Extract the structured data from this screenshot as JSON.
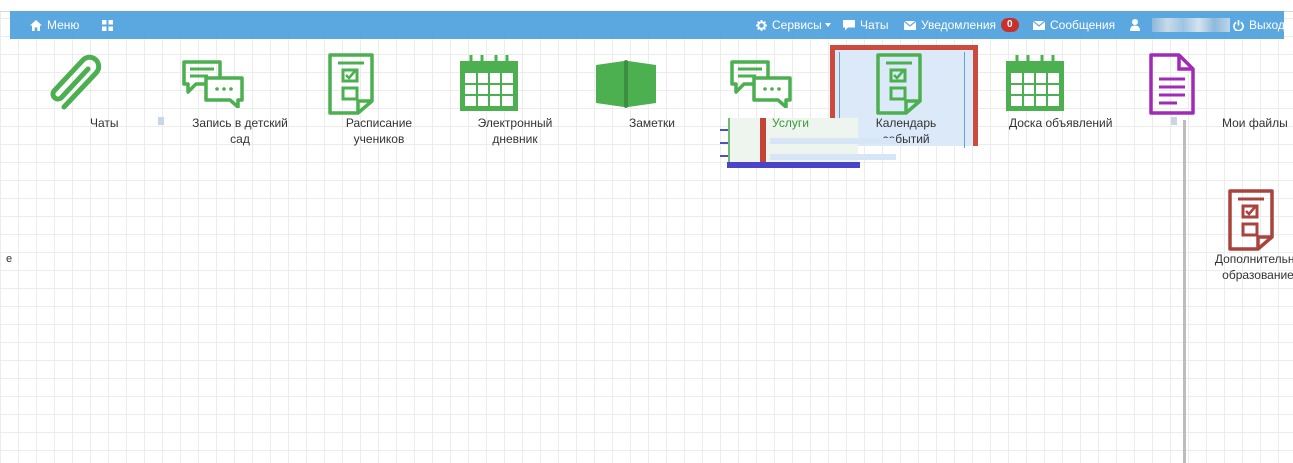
{
  "navbar": {
    "menu_label": "Меню",
    "services_label": "Сервисы",
    "chats_label": "Чаты",
    "notifications_label": "Уведомления",
    "notifications_count": "0",
    "messages_label": "Сообщения",
    "logout_label": "Выход",
    "bg_color": "#5ba7e0"
  },
  "tiles": {
    "chats": "Чаты",
    "kindergarten_line1": "Запись в детский",
    "kindergarten_line2": "сад",
    "schedule_line1": "Расписание",
    "schedule_line2": "учеников",
    "diary_line1": "Электронный",
    "diary_line2": "дневник",
    "notes": "Заметки",
    "services": "Услуги",
    "calendar_line1": "Календарь",
    "calendar_line2": "событий",
    "board": "Доска объявлений",
    "myfiles": "Мои файлы",
    "extra_line1": "Дополнительно",
    "extra_line2": "образование"
  },
  "fragments": {
    "left_cut": "е"
  },
  "colors": {
    "icon_green": "#4caf50",
    "icon_purple": "#a12bb8",
    "icon_red": "#a9433e",
    "highlight_border": "#cd4a3f"
  }
}
